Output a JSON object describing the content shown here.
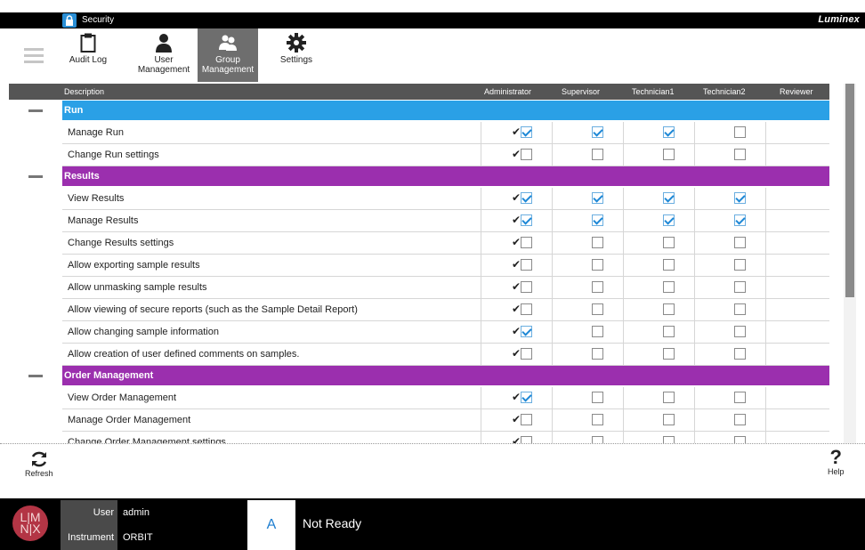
{
  "titlebar": {
    "title": "Security",
    "brand": "Luminex"
  },
  "toolbar": {
    "buttons": [
      {
        "label": "Audit Log",
        "icon": "clipboard-icon"
      },
      {
        "label": "User\nManagement",
        "icon": "user-icon"
      },
      {
        "label": "Group\nManagement",
        "icon": "group-icon",
        "active": true
      },
      {
        "label": "Settings",
        "icon": "gear-icon"
      }
    ]
  },
  "table": {
    "headers": [
      "Description",
      "Administrator",
      "Supervisor",
      "Technician1",
      "Technician2",
      "Reviewer"
    ],
    "sections": [
      {
        "name": "Run",
        "color": "#2aa0e6",
        "rows": [
          {
            "desc": "Manage Run",
            "perms": [
              true,
              true,
              true,
              false
            ]
          },
          {
            "desc": "Change Run settings",
            "perms": [
              false,
              false,
              false,
              false
            ]
          }
        ]
      },
      {
        "name": "Results",
        "color": "#9b2fae",
        "rows": [
          {
            "desc": "View Results",
            "perms": [
              true,
              true,
              true,
              true
            ]
          },
          {
            "desc": "Manage Results",
            "perms": [
              true,
              true,
              true,
              true
            ]
          },
          {
            "desc": "Change Results settings",
            "perms": [
              false,
              false,
              false,
              false
            ]
          },
          {
            "desc": "Allow exporting sample results",
            "perms": [
              false,
              false,
              false,
              false
            ]
          },
          {
            "desc": "Allow unmasking sample results",
            "perms": [
              false,
              false,
              false,
              false
            ]
          },
          {
            "desc": "Allow viewing of secure reports (such as the Sample Detail Report)",
            "perms": [
              false,
              false,
              false,
              false
            ]
          },
          {
            "desc": "Allow changing sample information",
            "perms": [
              true,
              false,
              false,
              false
            ]
          },
          {
            "desc": "Allow creation of user defined comments on samples.",
            "perms": [
              false,
              false,
              false,
              false
            ]
          }
        ]
      },
      {
        "name": "Order Management",
        "color": "#9b2fae",
        "rows": [
          {
            "desc": "View Order Management",
            "perms": [
              true,
              false,
              false,
              false
            ]
          },
          {
            "desc": "Manage Order Management",
            "perms": [
              false,
              false,
              false,
              false
            ]
          },
          {
            "desc": "Change Order Management settings",
            "perms": [
              false,
              false,
              false,
              false
            ]
          }
        ]
      }
    ],
    "admin_mark": "✔"
  },
  "actions": {
    "refresh": "Refresh",
    "help": "Help"
  },
  "status": {
    "user_label": "User",
    "user_value": "admin",
    "instrument_label": "Instrument",
    "instrument_value": "ORBIT",
    "slot": "A",
    "state": "Not Ready",
    "logo_top": "L|M",
    "logo_bottom": "N|X"
  }
}
